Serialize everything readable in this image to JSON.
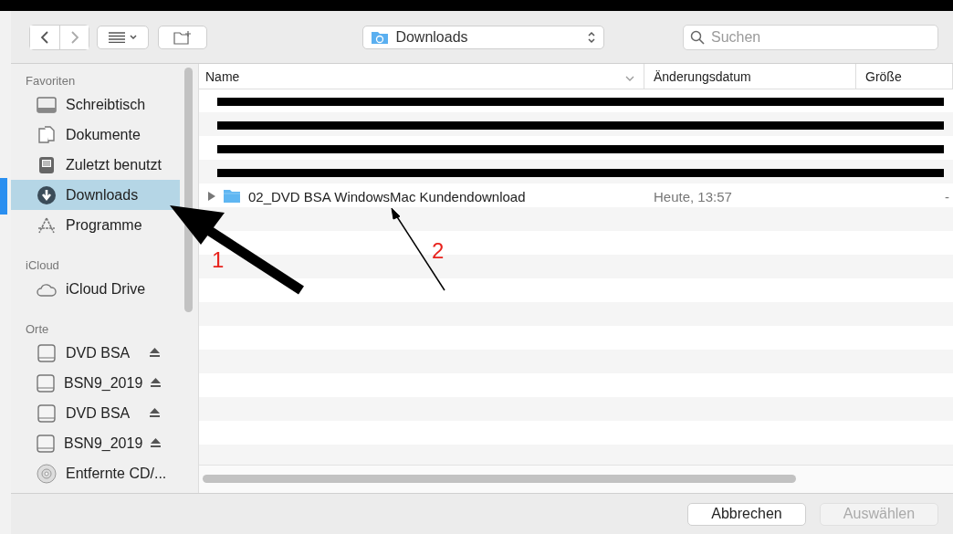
{
  "toolbar": {
    "location": "Downloads",
    "search": {
      "placeholder": "Suchen"
    }
  },
  "sidebar": {
    "sections": [
      {
        "heading": "Favoriten",
        "items": [
          {
            "label": "Schreibtisch",
            "kind": "desktop",
            "selected": false,
            "eject": false
          },
          {
            "label": "Dokumente",
            "kind": "documents",
            "selected": false,
            "eject": false
          },
          {
            "label": "Zuletzt benutzt",
            "kind": "recent",
            "selected": false,
            "eject": false
          },
          {
            "label": "Downloads",
            "kind": "downloads",
            "selected": true,
            "eject": false
          },
          {
            "label": "Programme",
            "kind": "apps",
            "selected": false,
            "eject": false
          }
        ]
      },
      {
        "heading": "iCloud",
        "items": [
          {
            "label": "iCloud Drive",
            "kind": "cloud",
            "selected": false,
            "eject": false
          }
        ]
      },
      {
        "heading": "Orte",
        "items": [
          {
            "label": "DVD BSA",
            "kind": "drive",
            "selected": false,
            "eject": true
          },
          {
            "label": "BSN9_2019",
            "kind": "drive",
            "selected": false,
            "eject": true
          },
          {
            "label": "DVD BSA",
            "kind": "drive",
            "selected": false,
            "eject": true
          },
          {
            "label": "BSN9_2019",
            "kind": "drive",
            "selected": false,
            "eject": true
          },
          {
            "label": "Entfernte CD/...",
            "kind": "disc",
            "selected": false,
            "eject": false
          }
        ]
      }
    ]
  },
  "table": {
    "columns": [
      "Name",
      "Änderungsdatum",
      "Größe"
    ],
    "rows": [
      {
        "kind": "redacted"
      },
      {
        "kind": "redacted"
      },
      {
        "kind": "redacted"
      },
      {
        "kind": "redacted"
      },
      {
        "kind": "folder",
        "name": "02_DVD BSA WindowsMac Kundendownload",
        "date": "Heute, 13:57",
        "size": "-"
      }
    ]
  },
  "buttons": [
    {
      "label": "Abbrechen",
      "disabled": false
    },
    {
      "label": "Auswählen",
      "disabled": true
    }
  ],
  "annotations": [
    {
      "label": "1"
    },
    {
      "label": "2"
    }
  ]
}
